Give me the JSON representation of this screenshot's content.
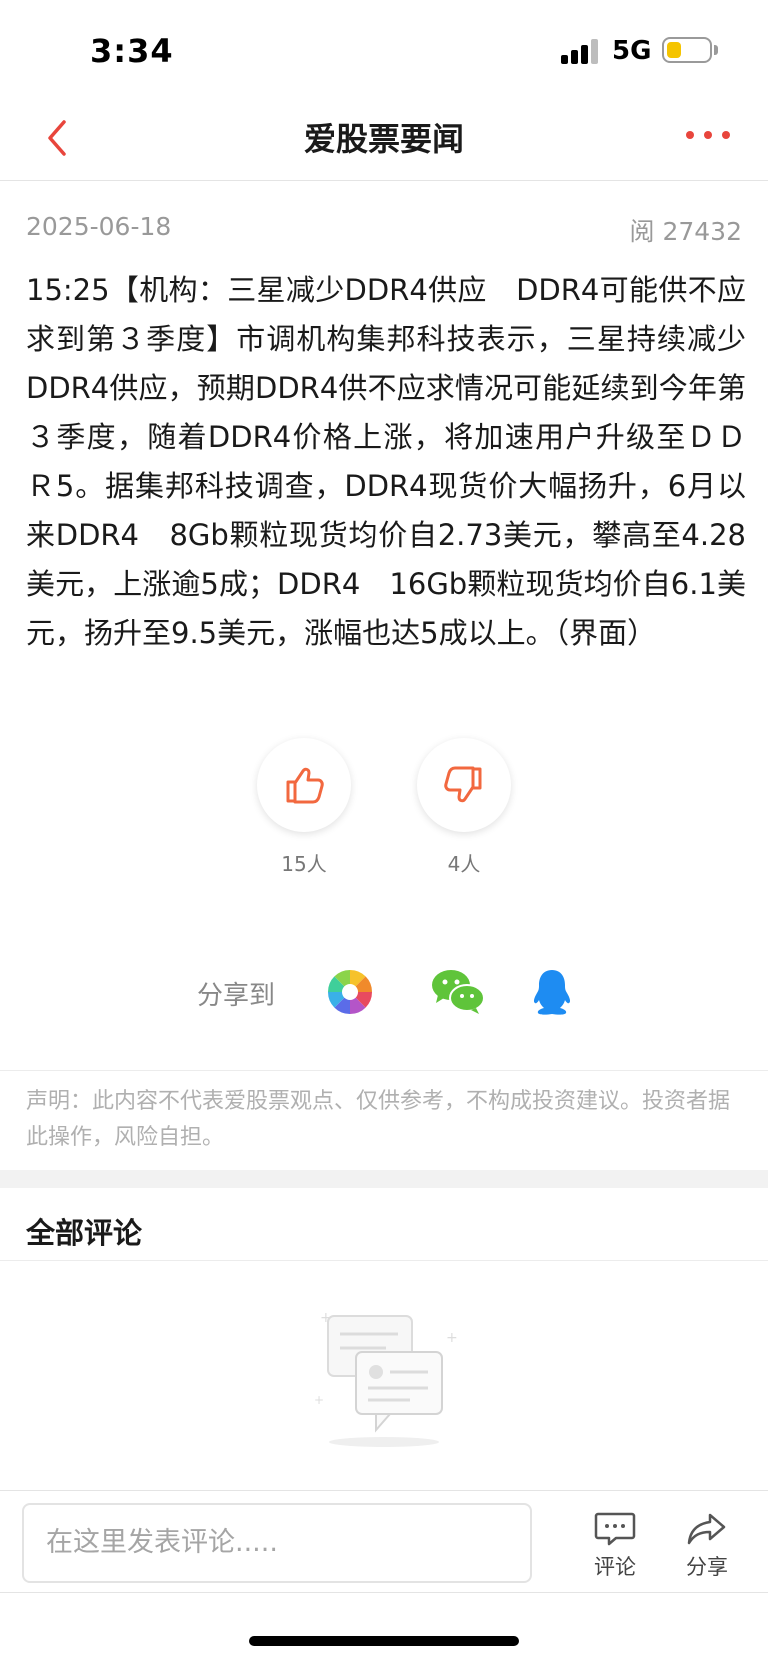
{
  "status_bar": {
    "time": "3:34",
    "network": "5G",
    "battery_color": "#f5c400"
  },
  "nav": {
    "title": "爱股票要闻",
    "accent_color": "#e8453c"
  },
  "meta": {
    "date": "2025-06-18",
    "reads": "阅 27432"
  },
  "article": {
    "body": "15:25【机构：三星减少DDR4供应　DDR4可能供不应求到第３季度】市调机构集邦科技表示，三星持续减少DDR4供应，预期DDR4供不应求情况可能延续到今年第３季度，随着DDR4价格上涨，将加速用户升级至ＤＤＲ5。据集邦科技调查，DDR4现货价大幅扬升，6月以来DDR4　8Gb颗粒现货均价自2.73美元，攀高至4.28美元，上涨逾5成；DDR4　16Gb颗粒现货均价自6.1美元，扬升至9.5美元，涨幅也达5成以上。（界面）"
  },
  "votes": {
    "like_count": "15人",
    "dislike_count": "4人",
    "icon_color": "#f2683f"
  },
  "share": {
    "label": "分享到",
    "targets": [
      "moments-icon",
      "wechat-icon",
      "qq-icon"
    ]
  },
  "disclaimer": "声明：此内容不代表爱股票观点、仅供参考，不构成投资建议。投资者据此操作，风险自担。",
  "comments": {
    "title": "全部评论"
  },
  "bottom_bar": {
    "input_placeholder": "在这里发表评论.....",
    "comment_label": "评论",
    "share_label": "分享"
  }
}
